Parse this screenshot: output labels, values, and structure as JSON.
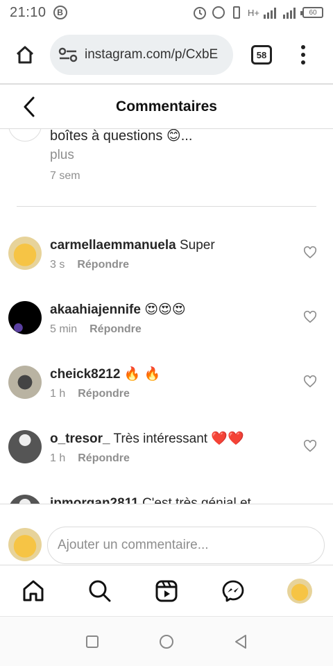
{
  "status": {
    "time": "21:10",
    "b_badge": "B",
    "network": "H+",
    "battery": "60"
  },
  "browser": {
    "url": "instagram.com/p/CxbE",
    "tab_count": "58"
  },
  "header": {
    "title": "Commentaires"
  },
  "caption": {
    "text": "boîtes à questions 😊...",
    "more": "plus",
    "time": "7 sem"
  },
  "comments": [
    {
      "username": "carmellaemmanuela",
      "text": "Super",
      "time": "3 s",
      "reply": "Répondre"
    },
    {
      "username": "akaahiajennife",
      "text": "😍😍😍",
      "time": "5 min",
      "reply": "Répondre"
    },
    {
      "username": "cheick8212",
      "text": "🔥 🔥",
      "time": "1 h",
      "reply": "Répondre"
    },
    {
      "username": "o_tresor_",
      "text": "Très intéressant ❤️❤️",
      "time": "1 h",
      "reply": "Répondre"
    },
    {
      "username": "jpmorgan2811",
      "text": "C'est très génial et",
      "time": "",
      "reply": ""
    }
  ],
  "add_comment": {
    "placeholder": "Ajouter un commentaire..."
  },
  "colors": {
    "text": "#262626",
    "secondary": "#8e8e8e",
    "border": "#dbdbdb"
  },
  "icons": {
    "nav": [
      "home-icon",
      "search-icon",
      "reels-icon",
      "messenger-icon",
      "profile-avatar"
    ],
    "android": [
      "recents-square-icon",
      "home-circle-icon",
      "back-triangle-icon"
    ]
  }
}
